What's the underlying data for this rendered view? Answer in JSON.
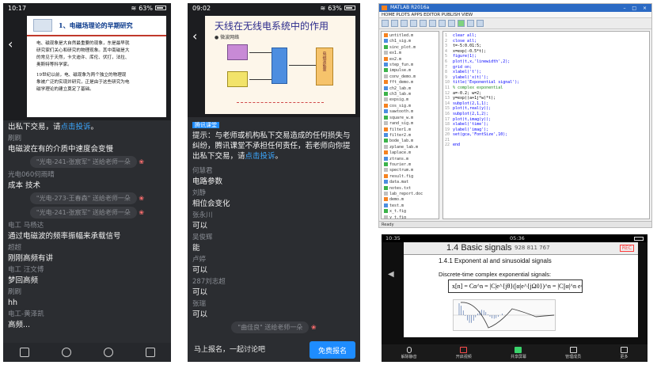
{
  "phone1": {
    "status": {
      "time": "10:17",
      "battery": "63%"
    },
    "slide": {
      "title": "1、电磁场理论的早期研究",
      "body": [
        "电、磁现象是大自然最重要的现象，东是最早就",
        "研究家们关心和研究的物理现象。其中南磁是大",
        "的常见于天然，卡文迪许、库伦、伏打，法拉、",
        "奥斯特等科学家。",
        "19世纪以前，电、磁现象为两个独立的物理现",
        "象被广泛的实现并研究，正是由于这些研究为电",
        "磁学理论的建立奠定了基础。"
      ]
    },
    "chat": [
      {
        "kind": "msg",
        "text": "出私下交易，请",
        "link": "点击投诉",
        "tail": "。"
      },
      {
        "kind": "who",
        "text": "刷刷"
      },
      {
        "kind": "msg",
        "text": "电磁波在有的介质中速度会变慢"
      },
      {
        "kind": "sys",
        "text": "\"光电-241-张宸军\" 送给老师一朵"
      },
      {
        "kind": "who",
        "text": "光电060何雨晴"
      },
      {
        "kind": "msg",
        "text": "成本 技术"
      },
      {
        "kind": "sys",
        "text": "\"光电-273-王春森\" 送给老师一朵"
      },
      {
        "kind": "sys",
        "text": "\"光电-241-张宸军\" 送给老师一朵"
      },
      {
        "kind": "who",
        "text": "电工 马杨达"
      },
      {
        "kind": "msg",
        "text": "通过电磁波的频率振幅来承载信号"
      },
      {
        "kind": "who",
        "text": "超超"
      },
      {
        "kind": "msg",
        "text": "刚刚高频有讲"
      },
      {
        "kind": "who",
        "text": "电工 汪文博"
      },
      {
        "kind": "msg",
        "text": "梦回高频"
      },
      {
        "kind": "who",
        "text": "刷刷"
      },
      {
        "kind": "msg",
        "text": "hh"
      },
      {
        "kind": "who",
        "text": "电工-黄泽凯"
      },
      {
        "kind": "msg",
        "text": "高频..."
      }
    ]
  },
  "phone2": {
    "status": {
      "time": "09:02",
      "battery": "63%"
    },
    "slide": {
      "title": "天线在无线电系统中的作用",
      "bullet": "● 微波网络",
      "box_right": "电磁波能量"
    },
    "tag": "腾讯课堂",
    "notice": "提示：与老师或机构私下交易造成的任何损失与纠纷，腾讯课堂不承担任何责任，若老师向你提出私下交易，请",
    "notice_link": "点击投诉",
    "notice_tail": "。",
    "chat": [
      {
        "kind": "who",
        "text": "何慧君"
      },
      {
        "kind": "msg",
        "text": "电路参数"
      },
      {
        "kind": "who",
        "text": "刘静"
      },
      {
        "kind": "msg",
        "text": "相位会变化"
      },
      {
        "kind": "who",
        "text": "张永川"
      },
      {
        "kind": "msg",
        "text": "可以"
      },
      {
        "kind": "who",
        "text": "吴俊辉"
      },
      {
        "kind": "msg",
        "text": "能"
      },
      {
        "kind": "who",
        "text": "卢婷"
      },
      {
        "kind": "msg",
        "text": "可以"
      },
      {
        "kind": "who",
        "text": "287刘志超"
      },
      {
        "kind": "msg",
        "text": "可以"
      },
      {
        "kind": "who",
        "text": "张瑞"
      },
      {
        "kind": "msg",
        "text": "可以"
      },
      {
        "kind": "sys",
        "text": "\"曲佳良\" 送给老师一朵"
      }
    ],
    "discuss": "马上报名，一起讨论吧",
    "cta": "免费报名"
  },
  "matlab": {
    "title": "MATLAB R2016a",
    "menu": "HOME   PLOTS   APPS   EDITOR   PUBLISH   VIEW",
    "files": [
      "untitled.m",
      "ch1_sig.m",
      "sinc_plot.m",
      "ex1.m",
      "ex2.m",
      "step_fun.m",
      "impulse.m",
      "conv_demo.m",
      "fft_demo.m",
      "ch2_lab.m",
      "ch3_lab.m",
      "expsig.m",
      "cos_sig.m",
      "sawtooth.m",
      "square_w.m",
      "rand_sig.m",
      "filter1.m",
      "filter2.m",
      "bode_lab.m",
      "zplane_lab.m",
      "laplace.m",
      "ztrans.m",
      "fourier.m",
      "spectrum.m",
      "result.fig",
      "data.mat",
      "notes.txt",
      "lab_report.doc",
      "demo.m",
      "test.m",
      "x_t.fig",
      "y_t.fig",
      "h_t.fig",
      "plot_all.m",
      "signal_gen.m",
      "sample.m",
      "a_plot.m",
      "b_plot.m"
    ],
    "code": [
      "clear all;",
      "close all;",
      "t=-5:0.01:5;",
      "x=exp(-0.5*t);",
      "figure(1);",
      "plot(t,x,'linewidth',2);",
      "grid on;",
      "xlabel('t');",
      "ylabel('x(t)');",
      "title('Exponential signal');",
      "% complex exponential",
      "a=-0.2; w=2;",
      "y=exp((a+1j*w)*t);",
      "subplot(2,1,1);",
      "plot(t,real(y));",
      "subplot(2,1,2);",
      "plot(t,imag(y));",
      "xlabel('time');",
      "ylabel('imag');",
      "set(gca,'FontSize',10);",
      "",
      "end"
    ],
    "status": "Ready"
  },
  "meeting": {
    "status": {
      "time": "10:35",
      "center": "05:36"
    },
    "slide_title": "1.4 Basic signals",
    "meeting_id": "928 811 767",
    "rec": "REC",
    "sub": "1.4.1 Exponent al and sinusoidal signals",
    "line": "Discrete-time complex exponential signals:",
    "equation": "x[n] = Cα^n = |C|e^{jθ}(|α|e^{jΩ0})^n = |C||α|^n e^{j(Ω0n+θ)}",
    "controls": [
      {
        "label": "解除静音"
      },
      {
        "label": "开启视频"
      },
      {
        "label": "共享屏幕"
      },
      {
        "label": "管理成员"
      },
      {
        "label": "更多"
      }
    ]
  }
}
